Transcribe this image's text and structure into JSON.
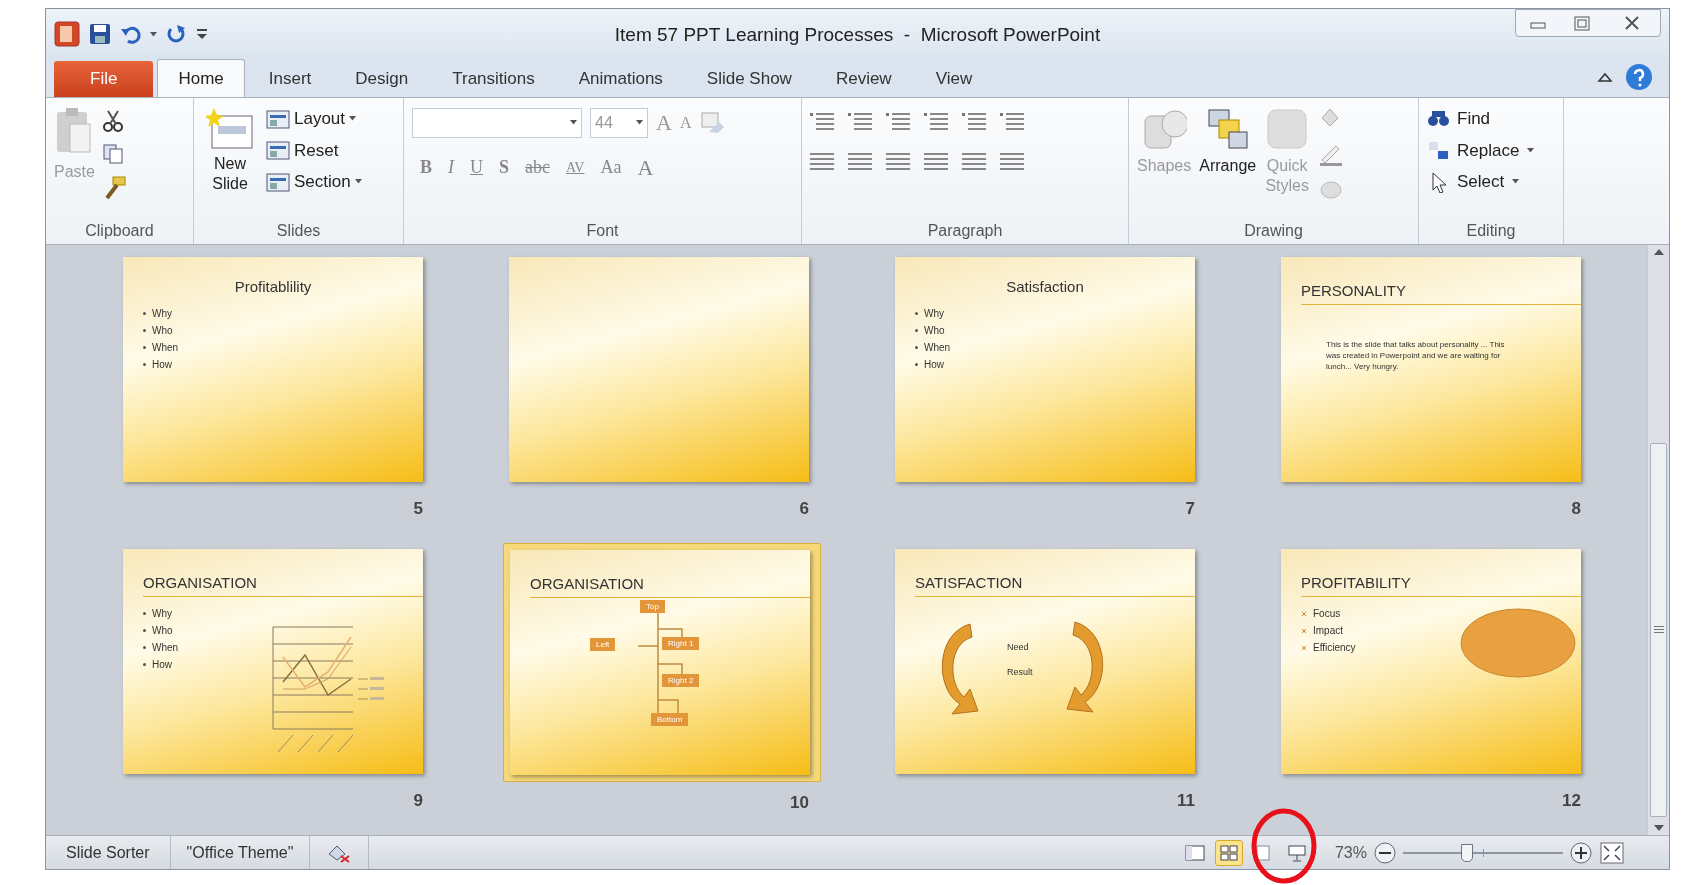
{
  "window": {
    "title": "Item 57 PPT Learning Processes  -  Microsoft PowerPoint"
  },
  "tabs": [
    {
      "label": "File",
      "kind": "file",
      "selected": false
    },
    {
      "label": "Home",
      "kind": "tab",
      "selected": true
    },
    {
      "label": "Insert",
      "kind": "tab",
      "selected": false
    },
    {
      "label": "Design",
      "kind": "tab",
      "selected": false
    },
    {
      "label": "Transitions",
      "kind": "tab",
      "selected": false
    },
    {
      "label": "Animations",
      "kind": "tab",
      "selected": false
    },
    {
      "label": "Slide Show",
      "kind": "tab",
      "selected": false
    },
    {
      "label": "Review",
      "kind": "tab",
      "selected": false
    },
    {
      "label": "View",
      "kind": "tab",
      "selected": false
    }
  ],
  "ribbon": {
    "clipboard": {
      "label": "Clipboard",
      "paste": {
        "label": "Paste",
        "disabled": true
      }
    },
    "slides": {
      "label": "Slides",
      "new_slide": "New Slide",
      "buttons": [
        "Layout",
        "Reset",
        "Section"
      ]
    },
    "font": {
      "label": "Font",
      "size": "44",
      "size_buttons": [
        "A",
        "A"
      ],
      "buttons": [
        "B",
        "I",
        "U",
        "S",
        "abc",
        "AV",
        "Aa",
        "A"
      ]
    },
    "paragraph": {
      "label": "Paragraph"
    },
    "drawing": {
      "label": "Drawing",
      "buttons": [
        {
          "label": "Shapes",
          "disabled": true
        },
        {
          "label": "Arrange",
          "disabled": false
        },
        {
          "label": "Quick Styles",
          "disabled": true
        }
      ]
    },
    "editing": {
      "label": "Editing",
      "buttons": [
        "Find",
        "Replace",
        "Select"
      ]
    }
  },
  "slides": [
    {
      "number": "5",
      "kind": "title_bullets",
      "selected": false,
      "title": "Profitablility",
      "bullets": [
        "Why",
        "Who",
        "When",
        "How"
      ]
    },
    {
      "number": "6",
      "kind": "blank",
      "selected": false
    },
    {
      "number": "7",
      "kind": "title_bullets",
      "selected": false,
      "title": "Satisfaction",
      "bullets": [
        "Why",
        "Who",
        "When",
        "How"
      ]
    },
    {
      "number": "8",
      "kind": "heading_text",
      "selected": false,
      "title": "PERSONALITY",
      "text": "This is the slide that talks about personality ...  This was created in Powerpoint and we are waiting for lunch... Very hungry."
    },
    {
      "number": "9",
      "kind": "heading_chart",
      "selected": false,
      "title": "ORGANISATION",
      "bullets": [
        "Why",
        "Who",
        "When",
        "How"
      ]
    },
    {
      "number": "10",
      "kind": "heading_org",
      "selected": true,
      "title": "ORGANISATION",
      "nodes": [
        "Top",
        "Left",
        "Right 1",
        "Right 2",
        "Bottom"
      ]
    },
    {
      "number": "11",
      "kind": "heading_cycle",
      "selected": false,
      "title": "SATISFACTION",
      "labels": [
        "Need",
        "Result"
      ]
    },
    {
      "number": "12",
      "kind": "heading_shape",
      "selected": false,
      "title": "PROFITABILITY",
      "bullets": [
        "Focus",
        "Impact",
        "Efficiency"
      ]
    }
  ],
  "status_bar": {
    "view": "Slide Sorter",
    "theme": "\"Office Theme\"",
    "views": [
      {
        "kind": "normal",
        "selected": false
      },
      {
        "kind": "sorter",
        "selected": true
      },
      {
        "kind": "reading",
        "selected": false
      },
      {
        "kind": "slideshow",
        "selected": false
      }
    ],
    "zoom": "73%",
    "zoom_level": {
      "level": 0.4
    }
  }
}
